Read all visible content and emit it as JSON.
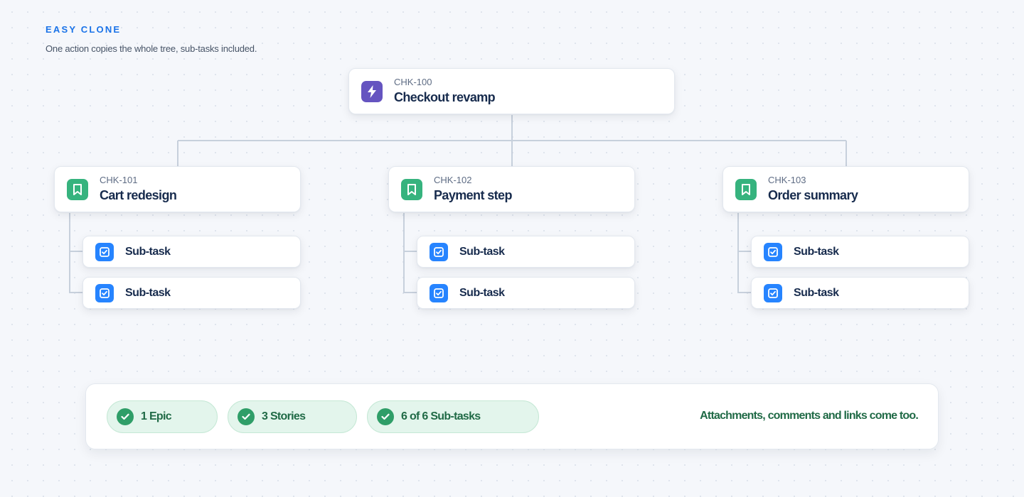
{
  "header": {
    "eyebrow": "EASY CLONE",
    "subtitle": "One action copies the whole tree, sub-tasks included."
  },
  "epic": {
    "key": "CHK-100",
    "title": "Checkout revamp",
    "icon": "lightning-icon"
  },
  "stories": [
    {
      "key": "CHK-101",
      "title": "Cart redesign",
      "icon": "bookmark-icon",
      "subtasks": [
        "Sub-task",
        "Sub-task"
      ]
    },
    {
      "key": "CHK-102",
      "title": "Payment step",
      "icon": "bookmark-icon",
      "subtasks": [
        "Sub-task",
        "Sub-task"
      ]
    },
    {
      "key": "CHK-103",
      "title": "Order summary",
      "icon": "bookmark-icon",
      "subtasks": [
        "Sub-task",
        "Sub-task"
      ]
    }
  ],
  "summary": {
    "chips": [
      "1 Epic",
      "3 Stories",
      "6 of 6 Sub-tasks"
    ],
    "note": "Attachments, comments and links come too."
  },
  "colors": {
    "accent": "#1a73e8",
    "epic": "#6554c0",
    "story": "#36b37e",
    "subtask": "#2684ff",
    "success": "#2f9e68",
    "success_text": "#206a46"
  }
}
